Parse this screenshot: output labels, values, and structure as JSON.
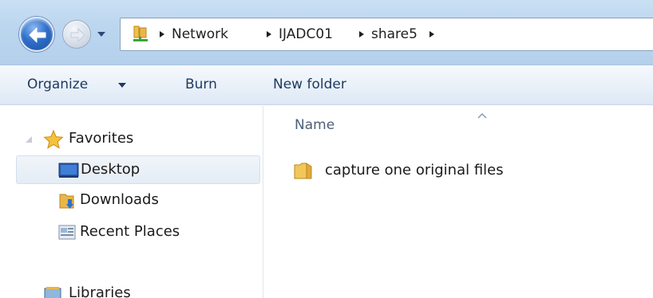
{
  "address": {
    "breadcrumbs": [
      "Network",
      "IJADC01",
      "share5"
    ]
  },
  "commandbar": {
    "organize_label": "Organize",
    "burn_label": "Burn",
    "new_folder_label": "New folder"
  },
  "navpane": {
    "favorites_label": "Favorites",
    "items": [
      {
        "label": "Desktop",
        "icon": "desktop-icon",
        "selected": true
      },
      {
        "label": "Downloads",
        "icon": "downloads-folder-icon",
        "selected": false
      },
      {
        "label": "Recent Places",
        "icon": "recent-places-icon",
        "selected": false
      }
    ],
    "libraries_label": "Libraries"
  },
  "content": {
    "column_header": "Name",
    "files": [
      {
        "name": "capture one original files",
        "icon": "folder-icon"
      }
    ]
  },
  "colors": {
    "titlebar": "#bcd6ef",
    "back_button": "#2f6fc9",
    "command_text": "#1e3a5f",
    "selection": "#e4ecf5",
    "folder": "#e9b649"
  }
}
